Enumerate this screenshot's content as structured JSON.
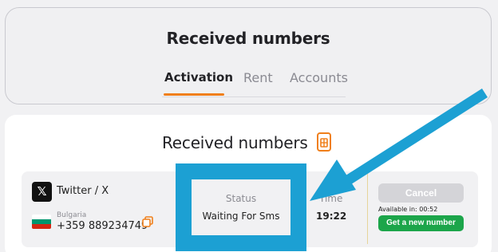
{
  "top": {
    "title": "Received numbers",
    "tabs": [
      {
        "label": "Activation",
        "active": true
      },
      {
        "label": "Rent",
        "active": false
      },
      {
        "label": "Accounts",
        "active": false
      }
    ]
  },
  "main": {
    "title": "Received numbers",
    "title_icon": "document-icon"
  },
  "row": {
    "service_icon": "x-logo-icon",
    "service": "Twitter / X",
    "country": "Bulgaria",
    "phone": "+359 889234749",
    "status_label": "Status",
    "status": "Waiting For Sms",
    "time_label": "Time",
    "time": "19:22",
    "cancel_label": "Cancel",
    "available_in": "Available in: 00:52",
    "new_number_label": "Get a new number"
  },
  "colors": {
    "accent": "#f07f1a",
    "highlight": "#1ca0d3",
    "success": "#1ca54a",
    "disabled": "#d4d4d8"
  }
}
